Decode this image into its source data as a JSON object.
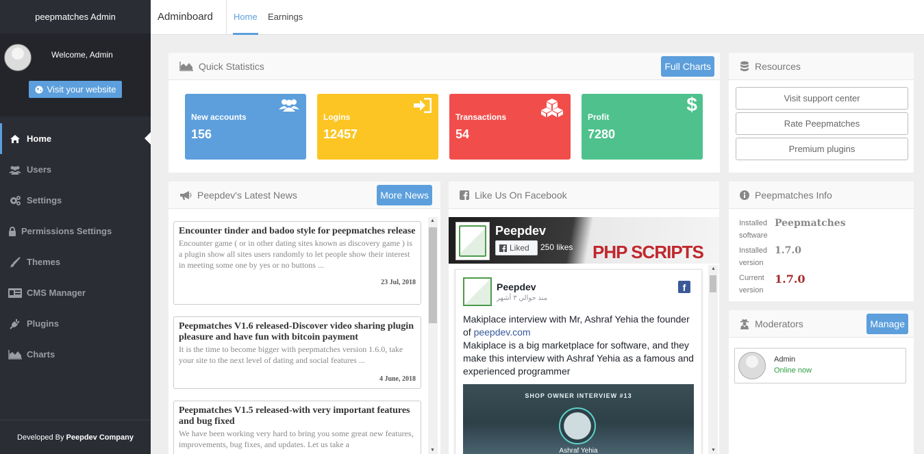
{
  "sidebar": {
    "brand": "peepmatches Admin",
    "welcome": "Welcome, Admin",
    "visit_button": "Visit your website",
    "items": [
      {
        "label": "Home",
        "icon": "home-icon"
      },
      {
        "label": "Users",
        "icon": "users-icon"
      },
      {
        "label": "Settings",
        "icon": "gears-icon"
      },
      {
        "label": "Permissions Settings",
        "icon": "lock-icon"
      },
      {
        "label": "Themes",
        "icon": "brush-icon"
      },
      {
        "label": "CMS Manager",
        "icon": "id-card-icon"
      },
      {
        "label": "Plugins",
        "icon": "plug-icon"
      },
      {
        "label": "Charts",
        "icon": "area-chart-icon"
      }
    ],
    "footer_prefix": "Developed By",
    "footer_company": "Peepdev Company"
  },
  "topbar": {
    "title": "Adminboard",
    "tabs": [
      "Home",
      "Earnings"
    ]
  },
  "quick_stats": {
    "title": "Quick Statistics",
    "button": "Full Charts",
    "cards": [
      {
        "label": "New accounts",
        "value": "156",
        "color": "#5c9fdc",
        "icon": "users-icon"
      },
      {
        "label": "Logins",
        "value": "12457",
        "color": "#fcc524",
        "icon": "sign-in-icon"
      },
      {
        "label": "Transactions",
        "value": "54",
        "color": "#f14e4b",
        "icon": "cubes-icon"
      },
      {
        "label": "Profit",
        "value": "7280",
        "color": "#4fc18d",
        "icon": "dollar-icon"
      }
    ]
  },
  "resources": {
    "title": "Resources",
    "buttons": [
      "Visit support center",
      "Rate Peepmatches",
      "Premium plugins"
    ]
  },
  "news": {
    "title": "Peepdev's Latest News",
    "button": "More News",
    "items": [
      {
        "title": "Encounter tinder and badoo style for peepmatches release",
        "text": "Encounter game ( or in other dating sites known as discovery game ) is a plugin show all sites users randomly to let people show their interest in meeting some one by yes or no buttons ...",
        "date": "23 Jul, 2018"
      },
      {
        "title": "Peepmatches V1.6 released-Discover video sharing plugin pleasure and have fun with bitcoin payment",
        "text": "It is the time to become bigger with peepmatches version 1.6.0, take your site to the next level of dating and social features ...",
        "date": "4 June, 2018"
      },
      {
        "title": "Peepmatches V1.5 released-with very important features and bug fixed",
        "text": "We have been working very hard to bring you some great new features, improvements, bug fixes, and updates. Let us take a",
        "date": ""
      }
    ]
  },
  "facebook": {
    "title": "Like Us On Facebook",
    "page_name": "Peepdev",
    "liked_label": "Liked",
    "likes": "250 likes",
    "cover_text": "PHP SCRIPTS",
    "post": {
      "author": "Peepdev",
      "time": "منذ حوالي ٣ أشهر",
      "text_before_link": "Makiplace interview with Mr, Ashraf Yehia the founder of",
      "link": "peepdev.com",
      "text_after_link": "Makiplace is a big marketplace for software, and they make this interview with Ashraf Yehia as a famous and experienced programmer",
      "image_title": "SHOP OWNER INTERVIEW #13",
      "image_name": "Ashraf Yehia"
    }
  },
  "info": {
    "title": "Peepmatches Info",
    "rows": [
      {
        "label": "Installed software",
        "value": "Peepmatches",
        "color": "#888888"
      },
      {
        "label": "Installed version",
        "value": "1.7.0",
        "color": "#888888"
      },
      {
        "label": "Current version",
        "value": "1.7.0",
        "color": "#a52a2a"
      }
    ]
  },
  "moderators": {
    "title": "Moderators",
    "button": "Manage",
    "items": [
      {
        "name": "Admin",
        "status": "Online now"
      }
    ]
  }
}
